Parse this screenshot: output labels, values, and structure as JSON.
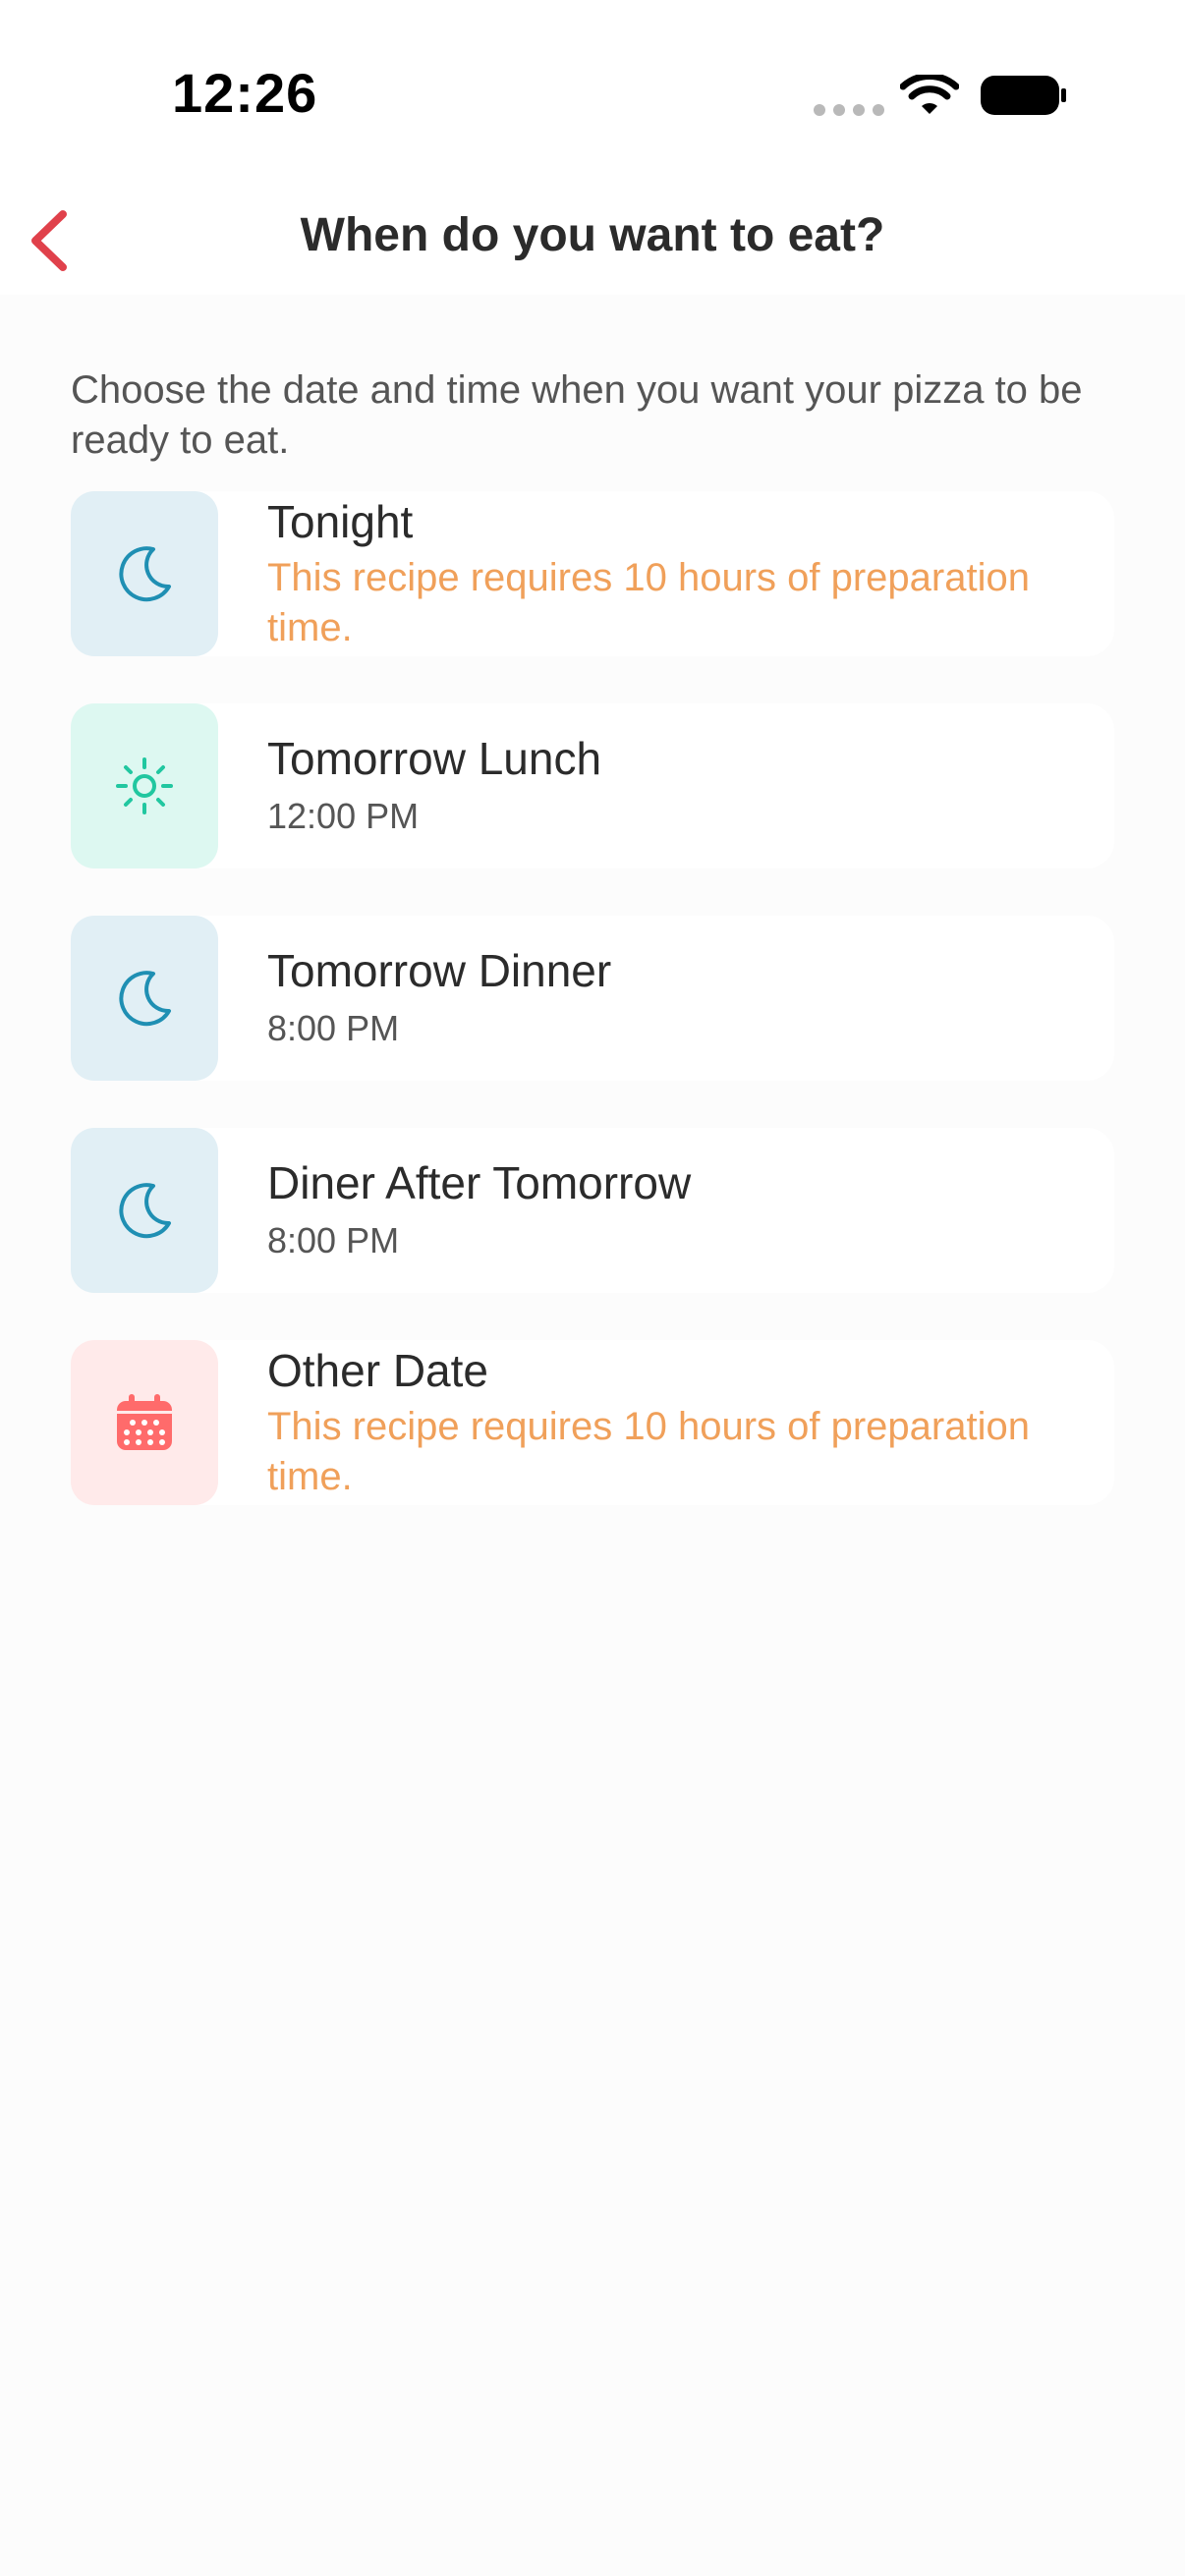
{
  "status_bar": {
    "time": "12:26"
  },
  "nav": {
    "title": "When do you want to eat?"
  },
  "description": "Choose the date and time when you want your pizza to be ready to eat.",
  "options": [
    {
      "title": "Tonight",
      "subtitle": "This recipe requires 10 hours of preparation time.",
      "subtitle_kind": "warning",
      "icon": "moon-icon"
    },
    {
      "title": "Tomorrow Lunch",
      "subtitle": "12:00 PM",
      "subtitle_kind": "time",
      "icon": "sun-icon"
    },
    {
      "title": "Tomorrow Dinner",
      "subtitle": "8:00 PM",
      "subtitle_kind": "time",
      "icon": "moon-icon"
    },
    {
      "title": "Diner After Tomorrow",
      "subtitle": "8:00 PM",
      "subtitle_kind": "time",
      "icon": "moon-icon"
    },
    {
      "title": "Other Date",
      "subtitle": "This recipe requires 10 hours of preparation time.",
      "subtitle_kind": "warning",
      "icon": "calendar-icon"
    }
  ],
  "colors": {
    "accent_red": "#e0414b",
    "warning_orange": "#f0a05a",
    "moon_blue": "#1f8fb3",
    "sun_teal": "#21c7a0",
    "calendar_red": "#ff6b6b"
  }
}
